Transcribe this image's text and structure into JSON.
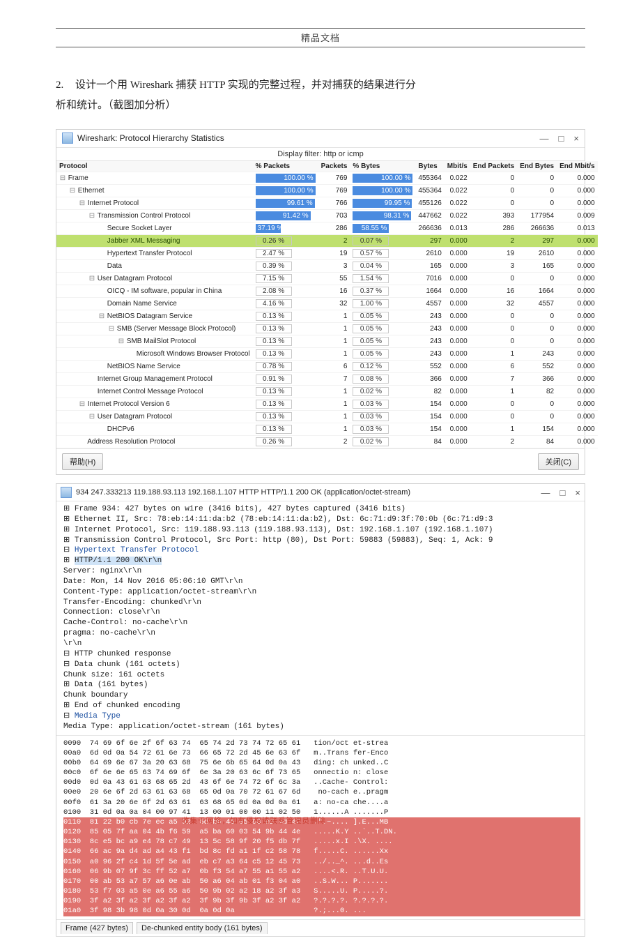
{
  "header_doc": "精品文档",
  "task": {
    "num": "2.",
    "text_a": "设计一个用 Wireshark 捕获 HTTP 实现的完整过程，并对捕获的结果进行分",
    "text_b": "析和统计。（截图加分析）"
  },
  "stats_window": {
    "title": "Wireshark: Protocol Hierarchy Statistics",
    "btn_min": "—",
    "btn_max": "□",
    "btn_close": "×",
    "filter_label": "Display filter: http or icmp",
    "columns": [
      "Protocol",
      "% Packets",
      "Packets",
      "% Bytes",
      "Bytes",
      "Mbit/s",
      "End Packets",
      "End Bytes",
      "End Mbit/s"
    ],
    "rows": [
      {
        "level": 0,
        "tree": "⊟",
        "name": "Frame",
        "pct_pkts": "100.00 %",
        "pkts": "769",
        "pct_bytes": "100.00 %",
        "bytes": "455364",
        "mbits": "0.022",
        "epkts": "0",
        "ebytes": "0",
        "embits": "0.000",
        "bar1": 100,
        "bar2": 100
      },
      {
        "level": 1,
        "tree": "⊟",
        "name": "Ethernet",
        "pct_pkts": "100.00 %",
        "pkts": "769",
        "pct_bytes": "100.00 %",
        "bytes": "455364",
        "mbits": "0.022",
        "epkts": "0",
        "ebytes": "0",
        "embits": "0.000",
        "bar1": 100,
        "bar2": 100
      },
      {
        "level": 2,
        "tree": "⊟",
        "name": "Internet Protocol",
        "pct_pkts": "99.61 %",
        "pkts": "766",
        "pct_bytes": "99.95 %",
        "bytes": "455126",
        "mbits": "0.022",
        "epkts": "0",
        "ebytes": "0",
        "embits": "0.000",
        "bar1": 99,
        "bar2": 99
      },
      {
        "level": 3,
        "tree": "⊟",
        "name": "Transmission Control Protocol",
        "pct_pkts": "91.42 %",
        "pkts": "703",
        "pct_bytes": "98.31 %",
        "bytes": "447662",
        "mbits": "0.022",
        "epkts": "393",
        "ebytes": "177954",
        "embits": "0.009",
        "bar1": 91,
        "bar2": 98
      },
      {
        "level": 4,
        "tree": "",
        "name": "Secure Socket Layer",
        "pct_pkts": "37.19 %",
        "pkts": "286",
        "pct_bytes": "58.55 %",
        "bytes": "266636",
        "mbits": "0.013",
        "epkts": "286",
        "ebytes": "266636",
        "embits": "0.013",
        "bar1": 37,
        "bar2": 58
      },
      {
        "level": 4,
        "tree": "",
        "name": "Jabber XML Messaging",
        "pct_pkts": "0.26 %",
        "pkts": "2",
        "pct_bytes": "0.07 %",
        "bytes": "297",
        "mbits": "0.000",
        "epkts": "2",
        "ebytes": "297",
        "embits": "0.000",
        "bar1": 0,
        "bar2": 0,
        "hl": true
      },
      {
        "level": 4,
        "tree": "",
        "name": "Hypertext Transfer Protocol",
        "pct_pkts": "2.47 %",
        "pkts": "19",
        "pct_bytes": "0.57 %",
        "bytes": "2610",
        "mbits": "0.000",
        "epkts": "19",
        "ebytes": "2610",
        "embits": "0.000",
        "bar1": 2,
        "bar2": 1
      },
      {
        "level": 4,
        "tree": "",
        "name": "Data",
        "pct_pkts": "0.39 %",
        "pkts": "3",
        "pct_bytes": "0.04 %",
        "bytes": "165",
        "mbits": "0.000",
        "epkts": "3",
        "ebytes": "165",
        "embits": "0.000",
        "bar1": 0,
        "bar2": 0
      },
      {
        "level": 3,
        "tree": "⊟",
        "name": "User Datagram Protocol",
        "pct_pkts": "7.15 %",
        "pkts": "55",
        "pct_bytes": "1.54 %",
        "bytes": "7016",
        "mbits": "0.000",
        "epkts": "0",
        "ebytes": "0",
        "embits": "0.000",
        "bar1": 7,
        "bar2": 2
      },
      {
        "level": 4,
        "tree": "",
        "name": "OICQ - IM software, popular in China",
        "pct_pkts": "2.08 %",
        "pkts": "16",
        "pct_bytes": "0.37 %",
        "bytes": "1664",
        "mbits": "0.000",
        "epkts": "16",
        "ebytes": "1664",
        "embits": "0.000",
        "bar1": 2,
        "bar2": 0
      },
      {
        "level": 4,
        "tree": "",
        "name": "Domain Name Service",
        "pct_pkts": "4.16 %",
        "pkts": "32",
        "pct_bytes": "1.00 %",
        "bytes": "4557",
        "mbits": "0.000",
        "epkts": "32",
        "ebytes": "4557",
        "embits": "0.000",
        "bar1": 4,
        "bar2": 1
      },
      {
        "level": 4,
        "tree": "⊟",
        "name": "NetBIOS Datagram Service",
        "pct_pkts": "0.13 %",
        "pkts": "1",
        "pct_bytes": "0.05 %",
        "bytes": "243",
        "mbits": "0.000",
        "epkts": "0",
        "ebytes": "0",
        "embits": "0.000",
        "bar1": 0,
        "bar2": 0
      },
      {
        "level": 5,
        "tree": "⊟",
        "name": "SMB (Server Message Block Protocol)",
        "pct_pkts": "0.13 %",
        "pkts": "1",
        "pct_bytes": "0.05 %",
        "bytes": "243",
        "mbits": "0.000",
        "epkts": "0",
        "ebytes": "0",
        "embits": "0.000",
        "bar1": 0,
        "bar2": 0
      },
      {
        "level": 6,
        "tree": "⊟",
        "name": "SMB MailSlot Protocol",
        "pct_pkts": "0.13 %",
        "pkts": "1",
        "pct_bytes": "0.05 %",
        "bytes": "243",
        "mbits": "0.000",
        "epkts": "0",
        "ebytes": "0",
        "embits": "0.000",
        "bar1": 0,
        "bar2": 0
      },
      {
        "level": 7,
        "tree": "",
        "name": "Microsoft Windows Browser Protocol",
        "pct_pkts": "0.13 %",
        "pkts": "1",
        "pct_bytes": "0.05 %",
        "bytes": "243",
        "mbits": "0.000",
        "epkts": "1",
        "ebytes": "243",
        "embits": "0.000",
        "bar1": 0,
        "bar2": 0
      },
      {
        "level": 4,
        "tree": "",
        "name": "NetBIOS Name Service",
        "pct_pkts": "0.78 %",
        "pkts": "6",
        "pct_bytes": "0.12 %",
        "bytes": "552",
        "mbits": "0.000",
        "epkts": "6",
        "ebytes": "552",
        "embits": "0.000",
        "bar1": 1,
        "bar2": 0
      },
      {
        "level": 3,
        "tree": "",
        "name": "Internet Group Management Protocol",
        "pct_pkts": "0.91 %",
        "pkts": "7",
        "pct_bytes": "0.08 %",
        "bytes": "366",
        "mbits": "0.000",
        "epkts": "7",
        "ebytes": "366",
        "embits": "0.000",
        "bar1": 1,
        "bar2": 0
      },
      {
        "level": 3,
        "tree": "",
        "name": "Internet Control Message Protocol",
        "pct_pkts": "0.13 %",
        "pkts": "1",
        "pct_bytes": "0.02 %",
        "bytes": "82",
        "mbits": "0.000",
        "epkts": "1",
        "ebytes": "82",
        "embits": "0.000",
        "bar1": 0,
        "bar2": 0
      },
      {
        "level": 2,
        "tree": "⊟",
        "name": "Internet Protocol Version 6",
        "pct_pkts": "0.13 %",
        "pkts": "1",
        "pct_bytes": "0.03 %",
        "bytes": "154",
        "mbits": "0.000",
        "epkts": "0",
        "ebytes": "0",
        "embits": "0.000",
        "bar1": 0,
        "bar2": 0
      },
      {
        "level": 3,
        "tree": "⊟",
        "name": "User Datagram Protocol",
        "pct_pkts": "0.13 %",
        "pkts": "1",
        "pct_bytes": "0.03 %",
        "bytes": "154",
        "mbits": "0.000",
        "epkts": "0",
        "ebytes": "0",
        "embits": "0.000",
        "bar1": 0,
        "bar2": 0
      },
      {
        "level": 4,
        "tree": "",
        "name": "DHCPv6",
        "pct_pkts": "0.13 %",
        "pkts": "1",
        "pct_bytes": "0.03 %",
        "bytes": "154",
        "mbits": "0.000",
        "epkts": "1",
        "ebytes": "154",
        "embits": "0.000",
        "bar1": 0,
        "bar2": 0
      },
      {
        "level": 2,
        "tree": "",
        "name": "Address Resolution Protocol",
        "pct_pkts": "0.26 %",
        "pkts": "2",
        "pct_bytes": "0.02 %",
        "bytes": "84",
        "mbits": "0.000",
        "epkts": "2",
        "ebytes": "84",
        "embits": "0.000",
        "bar1": 0,
        "bar2": 0
      }
    ],
    "btn_help": "帮助(H)",
    "btn_close_k": "关闭(C)"
  },
  "packet_window": {
    "title": "934 247.333213 119.188.93.113 192.168.1.107 HTTP HTTP/1.1 200 OK  (application/octet-stream)",
    "btn_min": "—",
    "btn_max": "□",
    "btn_close": "×",
    "lines": [
      {
        "pre": "⊞ ",
        "txt": "Frame 934: 427 bytes on wire (3416 bits), 427 bytes captured (3416 bits)"
      },
      {
        "pre": "⊞ ",
        "txt": "Ethernet II, Src: 78:eb:14:11:da:b2 (78:eb:14:11:da:b2), Dst: 6c:71:d9:3f:70:0b (6c:71:d9:3"
      },
      {
        "pre": "⊞ ",
        "txt": "Internet Protocol, Src: 119.188.93.113 (119.188.93.113), Dst: 192.168.1.107 (192.168.1.107)"
      },
      {
        "pre": "⊞ ",
        "txt": "Transmission Control Protocol, Src Port: http (80), Dst Port: 59883 (59883), Seq: 1, Ack: 9"
      },
      {
        "pre": "⊟ ",
        "txt": "Hypertext Transfer Protocol",
        "cls": "hl2"
      },
      {
        "pre": "  ⊞ ",
        "txt": "HTTP/1.1 200 OK\\r\\n",
        "cls": "sel"
      },
      {
        "pre": "    ",
        "txt": "Server: nginx\\r\\n"
      },
      {
        "pre": "    ",
        "txt": "Date: Mon, 14 Nov 2016 05:06:10 GMT\\r\\n"
      },
      {
        "pre": "    ",
        "txt": "Content-Type: application/octet-stream\\r\\n"
      },
      {
        "pre": "    ",
        "txt": "Transfer-Encoding: chunked\\r\\n"
      },
      {
        "pre": "    ",
        "txt": "Connection: close\\r\\n"
      },
      {
        "pre": "    ",
        "txt": "Cache-Control: no-cache\\r\\n"
      },
      {
        "pre": "    ",
        "txt": "pragma: no-cache\\r\\n"
      },
      {
        "pre": "    ",
        "txt": "\\r\\n"
      },
      {
        "pre": "  ⊟ ",
        "txt": "HTTP chunked response"
      },
      {
        "pre": "    ⊟ ",
        "txt": "Data chunk (161 octets)"
      },
      {
        "pre": "        ",
        "txt": "Chunk size: 161 octets"
      },
      {
        "pre": "      ⊞ ",
        "txt": "Data (161 bytes)"
      },
      {
        "pre": "        ",
        "txt": "Chunk boundary"
      },
      {
        "pre": "    ⊞ ",
        "txt": "End of chunked encoding"
      },
      {
        "pre": "⊟ ",
        "txt": "Media Type",
        "cls": "hl2"
      },
      {
        "pre": "    ",
        "txt": "Media Type: application/octet-stream (161 bytes)"
      }
    ],
    "hex_lines": [
      "0090  74 69 6f 6e 2f 6f 63 74  65 74 2d 73 74 72 65 61   tion/oct et-strea",
      "00a0  6d 0d 0a 54 72 61 6e 73  66 65 72 2d 45 6e 63 6f   m..Trans fer-Enco",
      "00b0  64 69 6e 67 3a 20 63 68  75 6e 6b 65 64 0d 0a 43   ding: ch unked..C",
      "00c0  6f 6e 6e 65 63 74 69 6f  6e 3a 20 63 6c 6f 73 65   onnectio n: close",
      "00d0  0d 0a 43 61 63 68 65 2d  43 6f 6e 74 72 6f 6c 3a   ..Cache- Control:",
      "00e0  20 6e 6f 2d 63 61 63 68  65 0d 0a 70 72 61 67 6d    no-cach e..pragm",
      "00f0  61 3a 20 6e 6f 2d 63 61  63 68 65 0d 0a 0d 0a 61   a: no-ca che....a",
      "0100  31 0d 0a 0a 04 00 97 41  13 00 01 00 00 11 02 50   1......A .......P"
    ],
    "hex_overlay": "收集于网络，如有侵权请联系管理员删除",
    "hex_masked": [
      "0110  81 22 b0 cb 7e ec a5 92  5d bb 45 05 93 e2 4d 42   .\".~.... ].E...MB",
      "0120  85 05 7f aa 04 4b f6 59  a5 ba 60 03 54 9b 44 4e   .....K.Y ..`..T.DN.",
      "0130  8c e5 bc a9 e4 78 c7 49  13 5c 58 9f 20 f5 db 7f   .....x.I .\\X. ....",
      "0140  66 ac 9a d4 ad a4 43 f1  bd 8c fd a1 1f c2 58 78   f.....C. ......Xx",
      "0150  a0 96 2f c4 1d 5f 5e ad  eb c7 a3 64 c5 12 45 73   ../.._^. ...d..Es",
      "0160  06 9b 07 9f 3c ff 52 a7  0b f3 54 a7 55 a1 55 a2   ....<.R. ..T.U.U.",
      "0170  00 ab 53 a7 57 a6 0e ab  50 a6 04 ab 01 f3 04 a0   ..S.W... P.......",
      "0180  53 f7 03 a5 0e a6 55 a6  50 9b 02 a2 18 a2 3f a3   S.....U. P.....?.",
      "0190  3f a2 3f a2 3f a2 3f a2  3f 9b 3f 9b 3f a2 3f a2   ?.?.?.?. ?.?.?.?.",
      "01a0  3f 98 3b 98 0d 0a 30 0d  0a 0d 0a                  ?.;...0. ..."
    ],
    "tabs": [
      "Frame (427 bytes)",
      "De-chunked entity body (161 bytes)"
    ]
  }
}
